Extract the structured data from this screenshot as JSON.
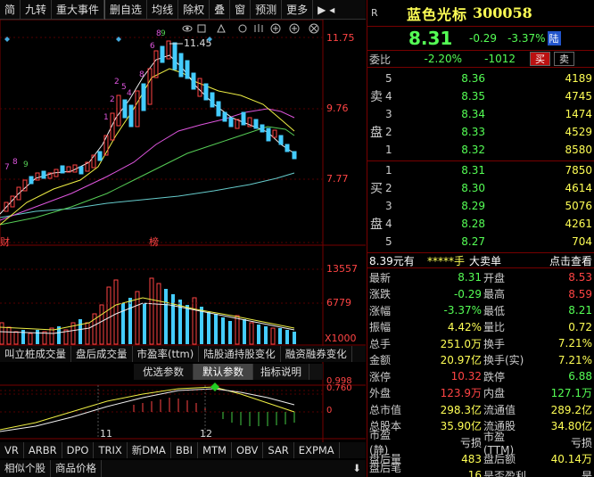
{
  "toolbar": {
    "items": [
      "简",
      "九转",
      "重大事件",
      "删自选",
      "均线",
      "除权",
      "叠",
      "窗",
      "预测",
      "更多"
    ],
    "menu_icon": "play-menu-icon"
  },
  "stock": {
    "tag": "R",
    "name": "蓝色光标",
    "code": "300058",
    "price": "8.31",
    "change": "-0.29",
    "change_pct": "-3.37%",
    "board": "陆"
  },
  "ratio": {
    "label": "委比",
    "pct": "-2.20%",
    "diff": "-1012",
    "buy_label": "买",
    "sell_label": "卖"
  },
  "asks": [
    {
      "level": "5",
      "price": "8.36",
      "vol": "4189"
    },
    {
      "level": "4",
      "price": "8.35",
      "vol": "4745"
    },
    {
      "level": "3",
      "price": "8.34",
      "vol": "1474"
    },
    {
      "level": "2",
      "price": "8.33",
      "vol": "4529"
    },
    {
      "level": "1",
      "price": "8.32",
      "vol": "8580"
    }
  ],
  "bids": [
    {
      "level": "1",
      "price": "8.31",
      "vol": "7850"
    },
    {
      "level": "2",
      "price": "8.30",
      "vol": "4614"
    },
    {
      "level": "3",
      "price": "8.29",
      "vol": "5076"
    },
    {
      "level": "4",
      "price": "8.28",
      "vol": "4261"
    },
    {
      "level": "5",
      "price": "8.27",
      "vol": "704"
    }
  ],
  "book_labels": {
    "sell_top": "卖",
    "sell_bottom": "盘",
    "buy_top": "买",
    "buy_bottom": "盘"
  },
  "summary": {
    "price_text": "8.39元有",
    "stars": "*****手",
    "big_order": "大卖单",
    "action": "点击查看"
  },
  "stats": [
    {
      "k1": "最新",
      "v1": "8.31",
      "c1": "grn",
      "k2": "开盘",
      "v2": "8.53",
      "c2": "red"
    },
    {
      "k1": "涨跌",
      "v1": "-0.29",
      "c1": "grn",
      "k2": "最高",
      "v2": "8.59",
      "c2": "red"
    },
    {
      "k1": "涨幅",
      "v1": "-3.37%",
      "c1": "grn",
      "k2": "最低",
      "v2": "8.21",
      "c2": "grn"
    },
    {
      "k1": "振幅",
      "v1": "4.42%",
      "c1": "yel",
      "k2": "量比",
      "v2": "0.72",
      "c2": "yel"
    },
    {
      "k1": "总手",
      "v1": "251.0万",
      "c1": "yel",
      "k2": "换手",
      "v2": "7.21%",
      "c2": "yel"
    },
    {
      "k1": "金额",
      "v1": "20.97亿",
      "c1": "yel",
      "k2": "换手(实)",
      "v2": "7.21%",
      "c2": "yel"
    },
    {
      "k1": "涨停",
      "v1": "10.32",
      "c1": "red",
      "k2": "跌停",
      "v2": "6.88",
      "c2": "grn"
    },
    {
      "k1": "外盘",
      "v1": "123.9万",
      "c1": "red",
      "k2": "内盘",
      "v2": "127.1万",
      "c2": "grn"
    },
    {
      "k1": "总市值",
      "v1": "298.3亿",
      "c1": "yel",
      "k2": "流通值",
      "v2": "289.2亿",
      "c2": "yel"
    },
    {
      "k1": "总股本",
      "v1": "35.90亿",
      "c1": "yel",
      "k2": "流通股",
      "v2": "34.80亿",
      "c2": "yel"
    },
    {
      "k1": "市盈(静)",
      "v1": "亏损",
      "c1": "wht",
      "k2": "市盈(TTM)",
      "v2": "亏损",
      "c2": "wht"
    },
    {
      "k1": "盘后量",
      "v1": "483",
      "c1": "yel",
      "k2": "盘后额",
      "v2": "40.14万",
      "c2": "yel"
    },
    {
      "k1": "盘后笔数",
      "v1": "16",
      "c1": "yel",
      "k2": "是否盈利",
      "v2": "是",
      "c2": "wht"
    }
  ],
  "chart": {
    "price_ticks": [
      "11.75",
      "9.76",
      "7.77"
    ],
    "high_label": "11.45",
    "vol_ticks": [
      "13557",
      "6779",
      "X1000"
    ],
    "macd_ticks": [
      "0.998",
      "0.760",
      "0"
    ],
    "bottom_labels": [
      "财",
      "榜"
    ],
    "date_labels": [
      "11",
      "12"
    ],
    "sub_tabs": [
      "叫立桩成交量",
      "盘后成交量",
      "市盈率(ttm)",
      "陆股通持股变化",
      "融资融券变化"
    ],
    "param_tabs": [
      "优选参数",
      "默认参数",
      "指标说明"
    ],
    "indicator_tabs": [
      "VR",
      "ARBR",
      "DPO",
      "TRIX",
      "新DMA",
      "BBI",
      "MTM",
      "OBV",
      "SAR",
      "EXPMA"
    ],
    "bottom_tabs": [
      "相似个股",
      "商品价格"
    ]
  }
}
